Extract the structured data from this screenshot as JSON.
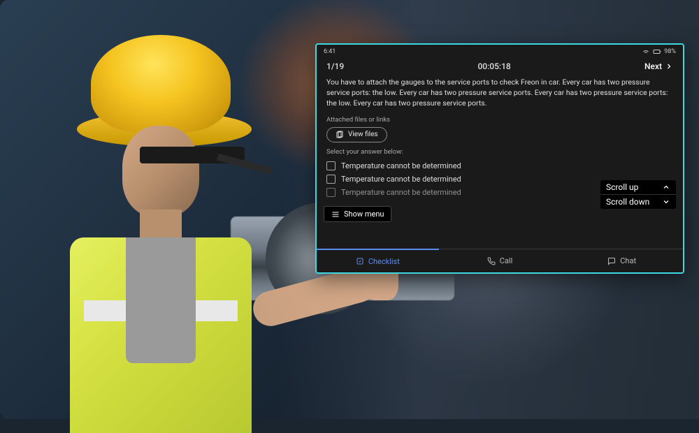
{
  "status_bar": {
    "time": "6:41",
    "battery_pct": "98%"
  },
  "topbar": {
    "progress": "1/19",
    "timer": "00:05:18",
    "next_label": "Next"
  },
  "instruction_text": "You have to attach the gauges to the service ports to check Freon in car. Every car has two pressure service ports: the low. Every car has two pressure service ports. Every car has two pressure service ports: the low. Every car has two pressure service ports.",
  "attached_section": {
    "label": "Attached files or links",
    "button_label": "View files"
  },
  "answers": {
    "label": "Select your answer below:",
    "options": [
      "Temperature cannot be determined",
      "Temperature cannot be determined",
      "Temperature cannot be determined"
    ]
  },
  "scroll_hint": {
    "up": "Scroll up",
    "down": "Scroll down"
  },
  "show_menu_label": "Show menu",
  "tabs": {
    "checklist": "Checklist",
    "call": "Call",
    "chat": "Chat"
  }
}
